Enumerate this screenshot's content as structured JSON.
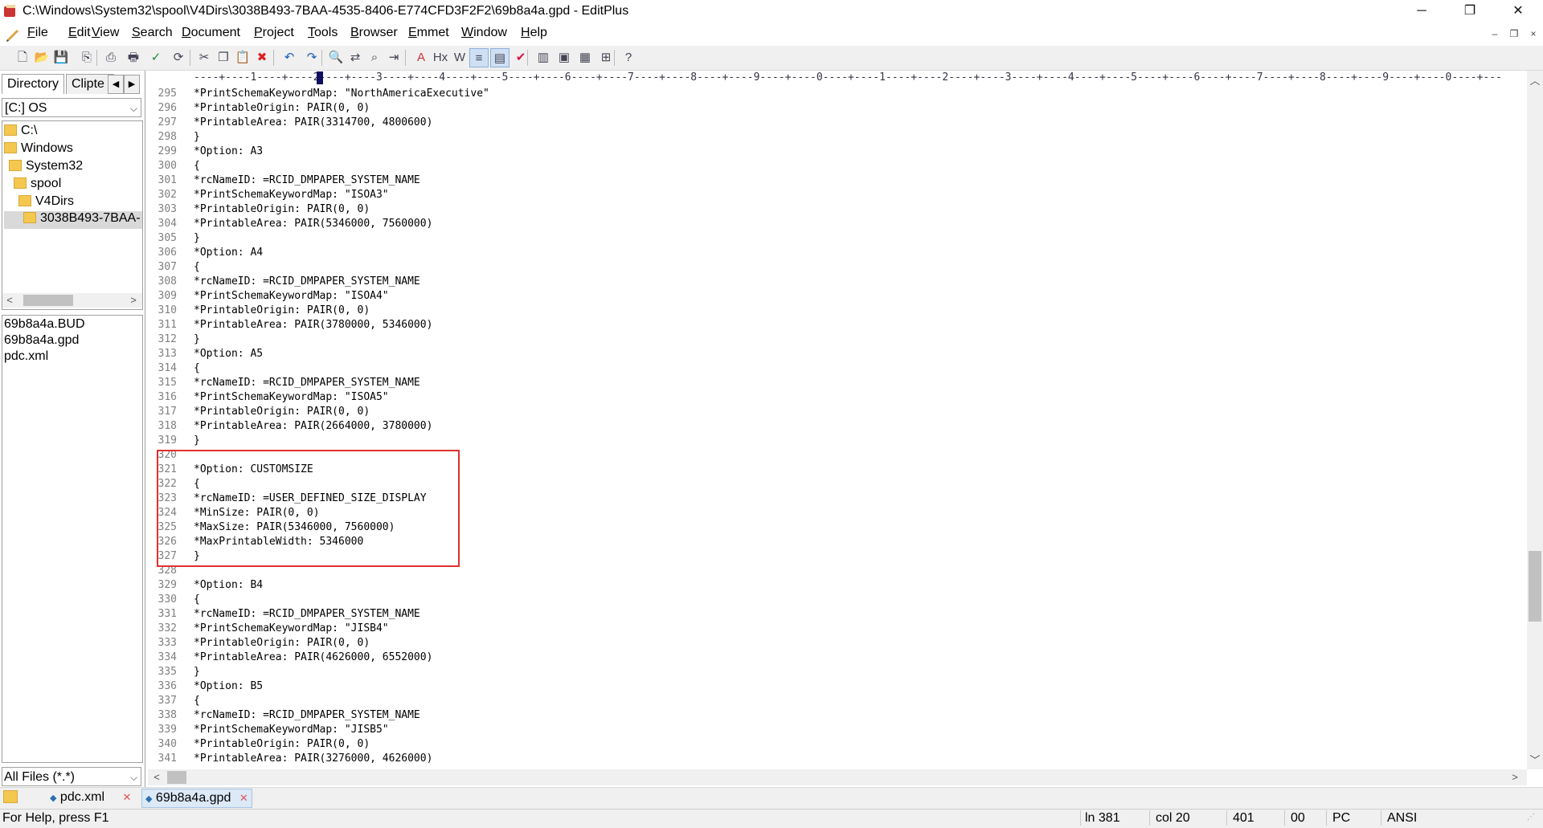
{
  "window": {
    "title": "C:\\Windows\\System32\\spool\\V4Dirs\\3038B493-7BAA-4535-8406-E774CFD3F2F2\\69b8a4a.gpd - EditPlus",
    "minimize": "─",
    "maximize": "❐",
    "close": "✕"
  },
  "menu": {
    "items": [
      "File",
      "Edit",
      "View",
      "Search",
      "Document",
      "Project",
      "Tools",
      "Browser",
      "Emmet",
      "Window",
      "Help"
    ],
    "mdi_min": "–",
    "mdi_restore": "❐",
    "mdi_close": "×"
  },
  "toolbar": {
    "icons": [
      "new-file-icon",
      "open-icon",
      "save-icon",
      "save-all-icon",
      "print-preview-icon",
      "print-icon",
      "spell-check-icon",
      "refresh-icon",
      "cut-icon",
      "copy-icon",
      "paste-icon",
      "delete-icon",
      "undo-icon",
      "redo-icon",
      "find-icon",
      "replace-icon",
      "find-in-files-icon",
      "goto-icon",
      "font-icon",
      "hex-icon",
      "word-wrap-icon",
      "line-number-icon",
      "ruler-icon",
      "check-icon",
      "split-icon",
      "screen-icon",
      "screen-full-icon",
      "browser-icon",
      "help-icon"
    ]
  },
  "left_panel": {
    "tabs": [
      "Directory",
      "Clipte"
    ],
    "drive": "[C:] OS",
    "tree": [
      "C:\\",
      "Windows",
      "System32",
      "spool",
      "V4Dirs",
      "3038B493-7BAA-"
    ],
    "files": [
      "69b8a4a.BUD",
      "69b8a4a.gpd",
      "pdc.xml"
    ],
    "filter": "All Files (*.*)"
  },
  "ruler": {
    "text": "----+----1----+----2----+----3----+----4----+----5----+----6----+----7----+----8----+----9----+----0----+----1----+----2----+----3----+----4----+----5----+----6----+----7----+----8----+----9----+----0----+---"
  },
  "editor": {
    "lines": [
      {
        "n": "295",
        "t": "*PrintSchemaKeywordMap: \"NorthAmericaExecutive\""
      },
      {
        "n": "296",
        "t": "*PrintableOrigin: PAIR(0, 0)"
      },
      {
        "n": "297",
        "t": "*PrintableArea: PAIR(3314700, 4800600)"
      },
      {
        "n": "298",
        "t": "}"
      },
      {
        "n": "299",
        "t": "*Option: A3"
      },
      {
        "n": "300",
        "t": "{"
      },
      {
        "n": "301",
        "t": "*rcNameID: =RCID_DMPAPER_SYSTEM_NAME"
      },
      {
        "n": "302",
        "t": "*PrintSchemaKeywordMap: \"ISOA3\""
      },
      {
        "n": "303",
        "t": "*PrintableOrigin: PAIR(0, 0)"
      },
      {
        "n": "304",
        "t": "*PrintableArea: PAIR(5346000, 7560000)"
      },
      {
        "n": "305",
        "t": "}"
      },
      {
        "n": "306",
        "t": "*Option: A4"
      },
      {
        "n": "307",
        "t": "{"
      },
      {
        "n": "308",
        "t": "*rcNameID: =RCID_DMPAPER_SYSTEM_NAME"
      },
      {
        "n": "309",
        "t": "*PrintSchemaKeywordMap: \"ISOA4\""
      },
      {
        "n": "310",
        "t": "*PrintableOrigin: PAIR(0, 0)"
      },
      {
        "n": "311",
        "t": "*PrintableArea: PAIR(3780000, 5346000)"
      },
      {
        "n": "312",
        "t": "}"
      },
      {
        "n": "313",
        "t": "*Option: A5"
      },
      {
        "n": "314",
        "t": "{"
      },
      {
        "n": "315",
        "t": "*rcNameID: =RCID_DMPAPER_SYSTEM_NAME"
      },
      {
        "n": "316",
        "t": "*PrintSchemaKeywordMap: \"ISOA5\""
      },
      {
        "n": "317",
        "t": "*PrintableOrigin: PAIR(0, 0)"
      },
      {
        "n": "318",
        "t": "*PrintableArea: PAIR(2664000, 3780000)"
      },
      {
        "n": "319",
        "t": "}"
      },
      {
        "n": "320",
        "t": ""
      },
      {
        "n": "321",
        "t": "*Option: CUSTOMSIZE"
      },
      {
        "n": "322",
        "t": "{"
      },
      {
        "n": "323",
        "t": "*rcNameID: =USER_DEFINED_SIZE_DISPLAY"
      },
      {
        "n": "324",
        "t": "*MinSize: PAIR(0, 0)"
      },
      {
        "n": "325",
        "t": "*MaxSize: PAIR(5346000, 7560000)"
      },
      {
        "n": "326",
        "t": "*MaxPrintableWidth: 5346000"
      },
      {
        "n": "327",
        "t": "}"
      },
      {
        "n": "328",
        "t": ""
      },
      {
        "n": "329",
        "t": "*Option: B4"
      },
      {
        "n": "330",
        "t": "{"
      },
      {
        "n": "331",
        "t": "*rcNameID: =RCID_DMPAPER_SYSTEM_NAME"
      },
      {
        "n": "332",
        "t": "*PrintSchemaKeywordMap: \"JISB4\""
      },
      {
        "n": "333",
        "t": "*PrintableOrigin: PAIR(0, 0)"
      },
      {
        "n": "334",
        "t": "*PrintableArea: PAIR(4626000, 6552000)"
      },
      {
        "n": "335",
        "t": "}"
      },
      {
        "n": "336",
        "t": "*Option: B5"
      },
      {
        "n": "337",
        "t": "{"
      },
      {
        "n": "338",
        "t": "*rcNameID: =RCID_DMPAPER_SYSTEM_NAME"
      },
      {
        "n": "339",
        "t": "*PrintSchemaKeywordMap: \"JISB5\""
      },
      {
        "n": "340",
        "t": "*PrintableOrigin: PAIR(0, 0)"
      },
      {
        "n": "341",
        "t": "*PrintableArea: PAIR(3276000, 4626000)"
      }
    ],
    "highlight_color": "#e03030"
  },
  "doc_tabs": [
    {
      "label": "pdc.xml",
      "active": false
    },
    {
      "label": "69b8a4a.gpd",
      "active": true
    }
  ],
  "status": {
    "help": "For Help, press F1",
    "line": "ln 381",
    "col": "col 20",
    "count": "401",
    "code": "00",
    "mode": "PC",
    "encoding": "ANSI"
  }
}
